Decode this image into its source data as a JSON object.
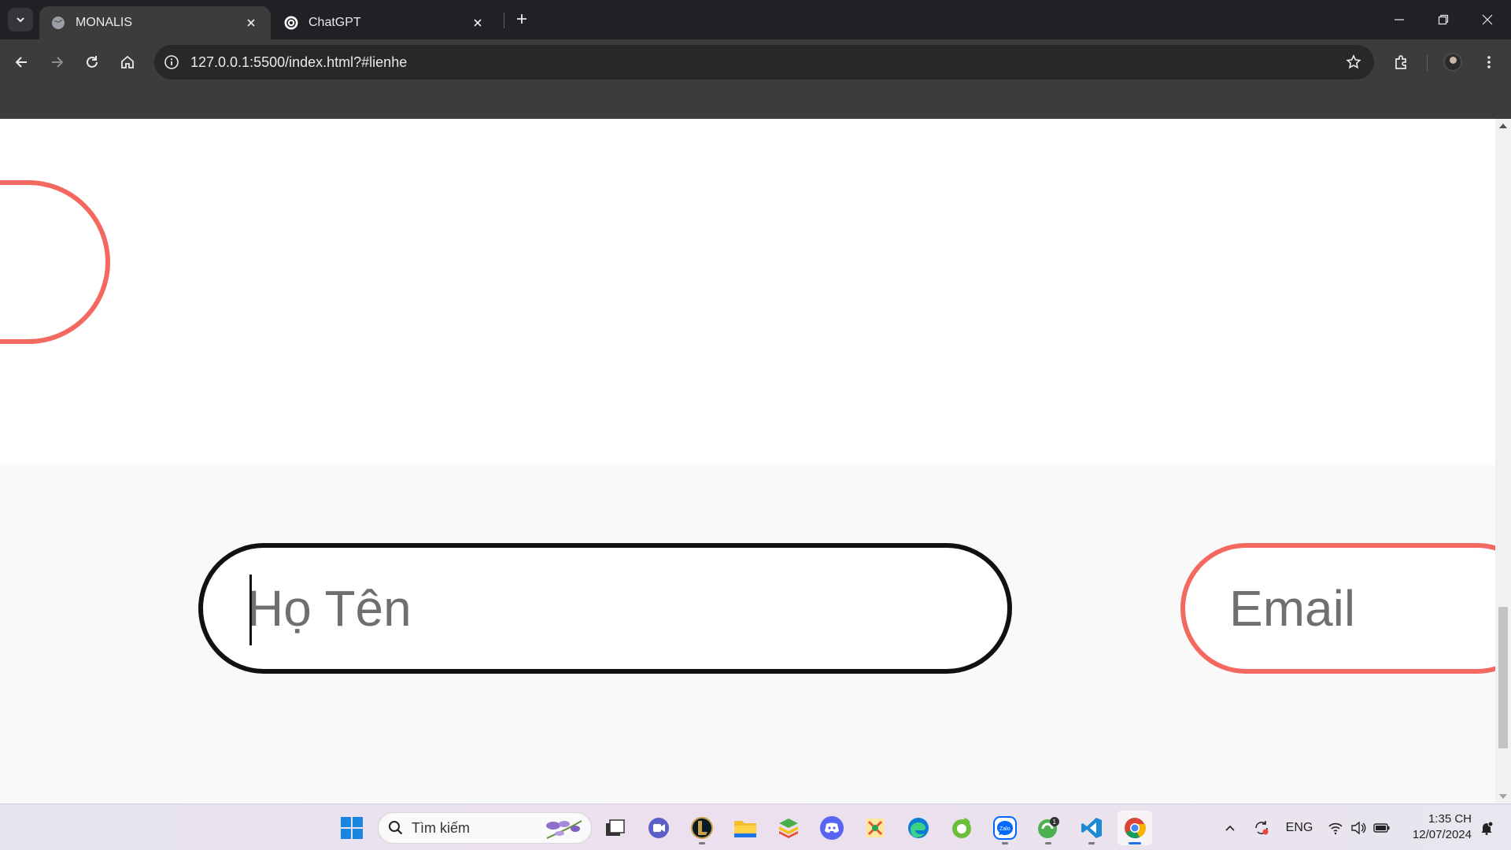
{
  "browser": {
    "tabs": [
      {
        "title": "MONALIS",
        "active": true
      },
      {
        "title": "ChatGPT",
        "active": false
      }
    ],
    "url": "127.0.0.1:5500/index.html?#lienhe"
  },
  "page": {
    "fields": {
      "name_placeholder": "Họ Tên",
      "email_placeholder": "Email"
    },
    "colors": {
      "accent": "#f4695f",
      "focus_border": "#111111",
      "section_bg": "#f9f9f9"
    }
  },
  "taskbar": {
    "search_placeholder": "Tìm kiếm",
    "language": "ENG",
    "time": "1:35 CH",
    "date": "12/07/2024",
    "pinned": [
      "task-view-icon",
      "teams-meet-icon",
      "league-of-legends-icon",
      "file-explorer-icon",
      "bluestacks-icon",
      "discord-icon",
      "game-icon",
      "edge-icon",
      "coccoc-icon",
      "zalo-icon",
      "chat-app-icon",
      "vscode-icon",
      "chrome-icon"
    ]
  }
}
